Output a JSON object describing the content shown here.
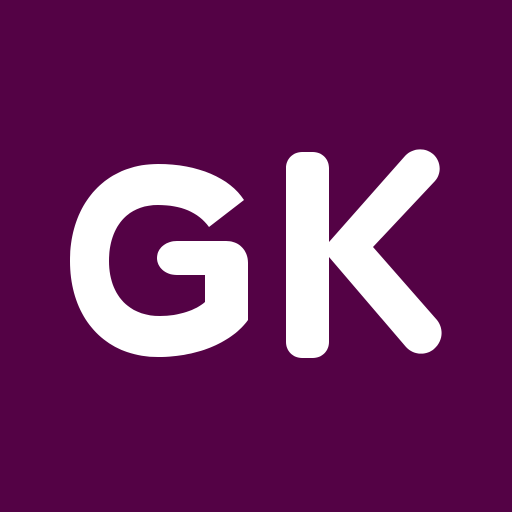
{
  "logo": {
    "monogram": "GK",
    "background_color": "#540245",
    "letter_color": "#FFFFFF"
  }
}
